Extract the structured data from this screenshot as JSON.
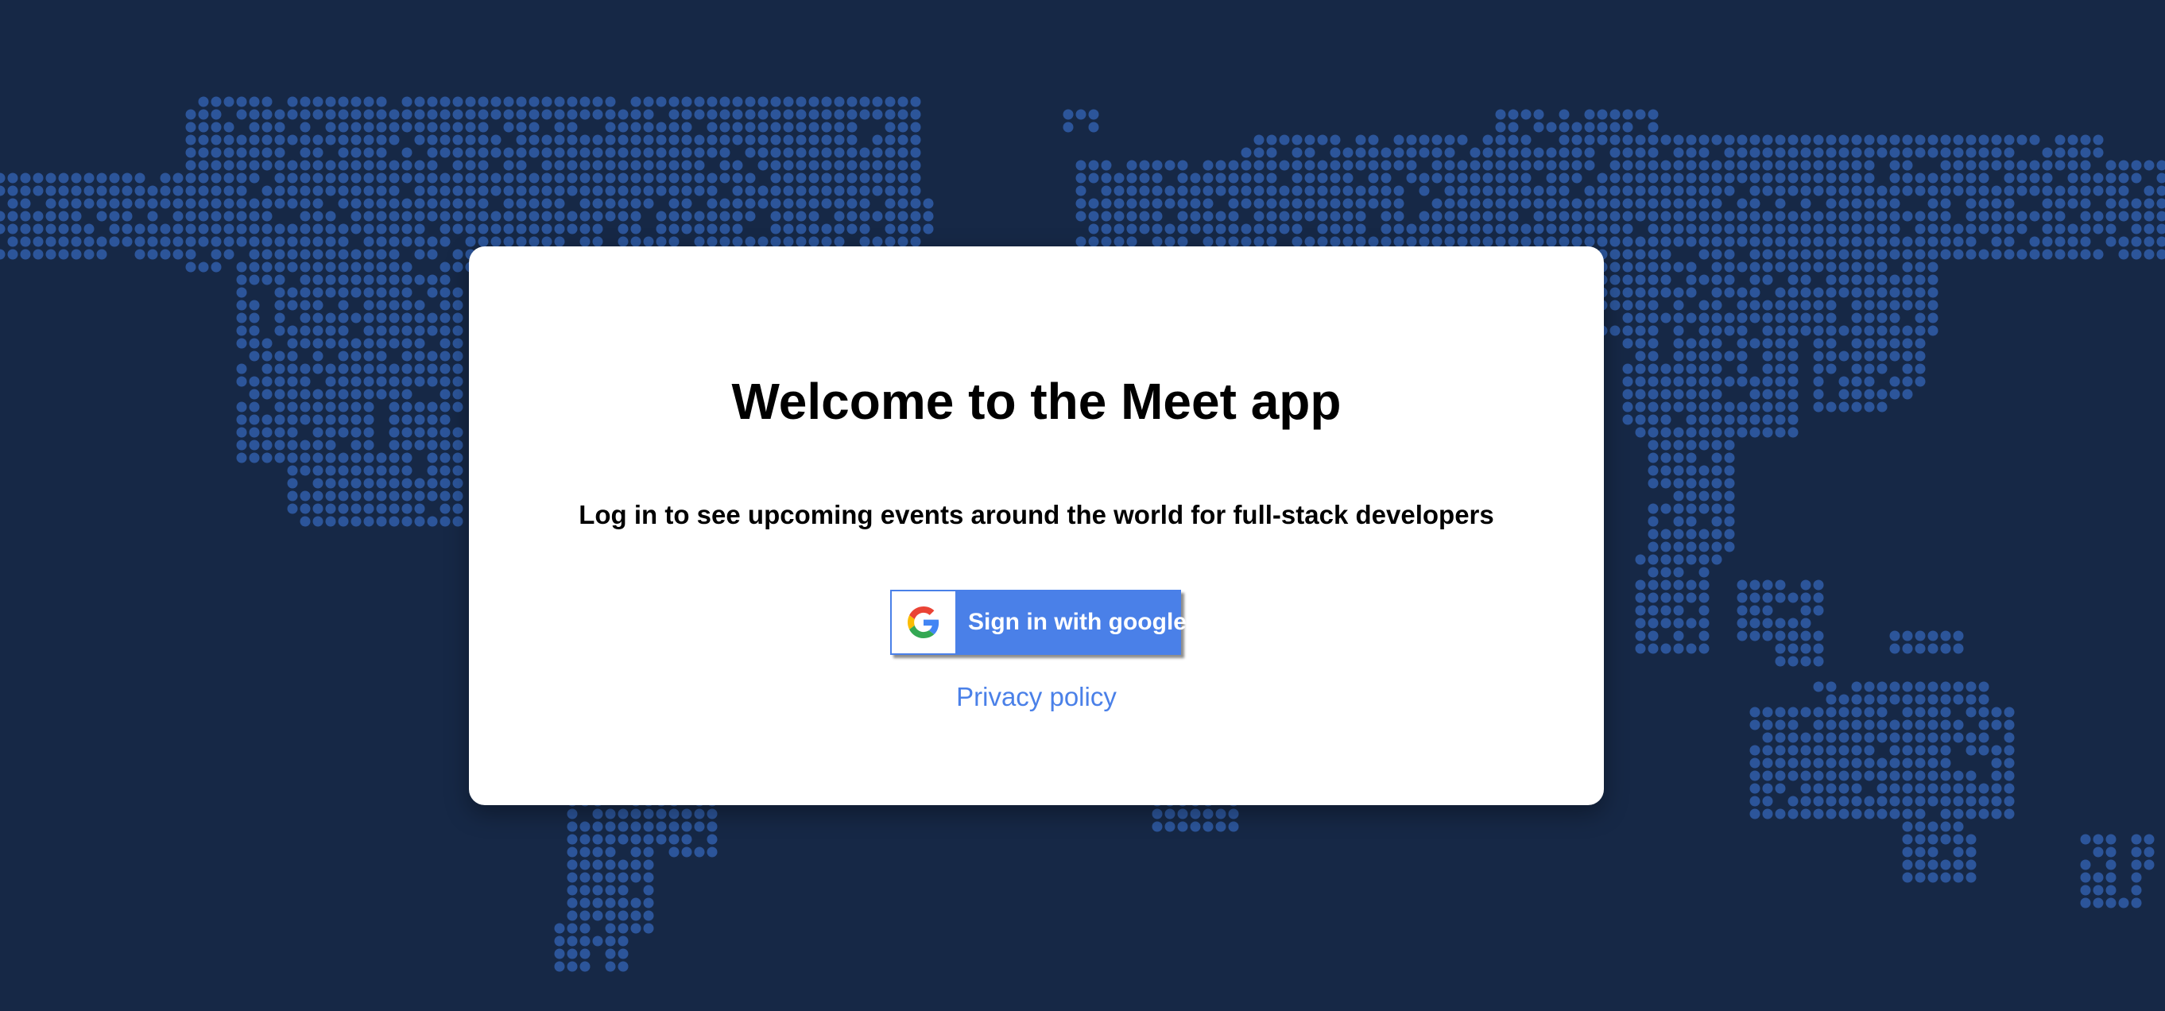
{
  "colors": {
    "background": "#162846",
    "map_dots": "#2c559a",
    "card": "#ffffff",
    "accent": "#4a80e8"
  },
  "card": {
    "title": "Welcome to the Meet app",
    "subtitle": "Log in to see upcoming events around the world for full-stack developers",
    "google_button_label": "Sign in with google",
    "google_button_icon": "google-g-icon",
    "privacy_link": "Privacy policy"
  },
  "background": {
    "image": "dotted-world-map"
  }
}
